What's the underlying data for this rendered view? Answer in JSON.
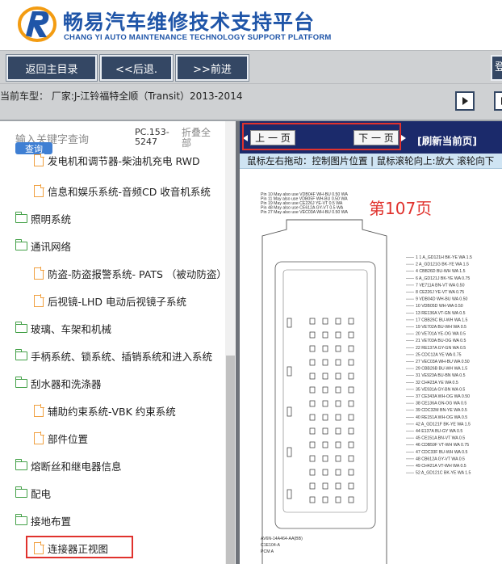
{
  "header": {
    "title": "畅易汽车维修技术支持平台",
    "subtitle": "CHANG YI AUTO MAINTENANCE TECHNOLOGY SUPPORT PLATFORM"
  },
  "toolbar": {
    "home_label": "返回主目录",
    "back_label": "<<后退.",
    "forward_label": ">>前进",
    "right_partial": "登"
  },
  "info": {
    "vehicle": "当前车型： 厂家:J-江铃福特全顺（Transit）2013-2014"
  },
  "search": {
    "placeholder": "输入关键字查询",
    "button": "查询",
    "pc_code": "PC.153-5247",
    "collapse": "折叠全部"
  },
  "tree": [
    {
      "label": "发电机和调节器-柴油机充电 RWD",
      "type": "page"
    },
    {
      "label": "信息和娱乐系统-音频CD 收音机系统",
      "type": "page"
    },
    {
      "label": "照明系统",
      "type": "folder"
    },
    {
      "label": "通讯网络",
      "type": "folder"
    },
    {
      "label": "防盗-防盗报警系统- PATS （被动防盗）",
      "type": "page"
    },
    {
      "label": "后视镜-LHD 电动后视镜子系统",
      "type": "page"
    },
    {
      "label": "玻璃、车架和机械",
      "type": "folder"
    },
    {
      "label": "手柄系统、锁系统、插销系统和进入系统",
      "type": "folder"
    },
    {
      "label": "刮水器和洗涤器",
      "type": "folder"
    },
    {
      "label": "辅助约束系统-VBK 约束系统",
      "type": "page"
    },
    {
      "label": "部件位置",
      "type": "page"
    },
    {
      "label": "熔断丝和继电器信息",
      "type": "folder"
    },
    {
      "label": "配电",
      "type": "folder"
    },
    {
      "label": "接地布置",
      "type": "folder"
    },
    {
      "label": "连接器正视图",
      "type": "page"
    }
  ],
  "viewer": {
    "prev": "上 一 页",
    "next": "下 一 页",
    "refresh": "[刷新当前页]",
    "hint": "鼠标左右拖动：控制图片位置 | 鼠标滚轮向上:放大   滚轮向下",
    "page": "第107页",
    "diagram_notes": [
      "Pin 10 May also use VDB04F WH-BU 0.50 WA",
      "Pin 11 May also use VDB05F WH-BU 0.50 WA",
      "Pin 19 May also use CE226J YE-VT 0.5 WA",
      "Pin 48 May also use CE612A GY-VT 0.5 WA",
      "Pin 27 May also use VEC03A WH-BU 0.50 WA"
    ],
    "diagram_footer": [
      "AV6N-14A464-AA(BB)",
      "C1E104-A",
      "PCM A"
    ],
    "pin_rows": [
      [
        "1",
        "",
        "",
        "1",
        "",
        "",
        "A_GD121H",
        "BK-YE",
        "WA 1.5"
      ],
      [
        "2",
        "A_GD121G",
        "BK-YE",
        "WA 1.5"
      ],
      [
        "4",
        "CBB26D",
        "BU-WH",
        "WA 1.5"
      ],
      [
        "6",
        "A_GD121J",
        "BK-YE",
        "WA 0.75"
      ],
      [
        "7",
        "VE711A",
        "BN-VT",
        "WA 0.50"
      ],
      [
        "8",
        "CE226J",
        "YE-VT",
        "WA 0.75"
      ],
      [
        "9",
        "VDB04D",
        "WH-BU",
        "WA 0.50"
      ],
      [
        "10",
        "VDB05D",
        "WH-WA",
        "0.50"
      ],
      [
        "13",
        "RE136A",
        "VT-GN",
        "WA 0.5"
      ],
      [
        "17",
        "CBB26C",
        "BU-WH",
        "WA 1.5"
      ],
      [
        "19",
        "VE702A",
        "BU-WH",
        "WA 0.5"
      ],
      [
        "20",
        "VE701A",
        "YE-OG",
        "WA 0.5"
      ],
      [
        "21",
        "VE703A",
        "BU-OG",
        "WA 0.5"
      ],
      [
        "22",
        "RE137A",
        "GY-GN",
        "WA 0.5"
      ],
      [
        "25",
        "CDC12A",
        "YE",
        "WA 0.75"
      ],
      [
        "27",
        "VEC03A",
        "WH-BU",
        "WA 0.50"
      ],
      [
        "29",
        "CBB26B",
        "BU-WH",
        "WA 1.5"
      ],
      [
        "31",
        "VE923A",
        "BU-BN",
        "WA 0.5"
      ],
      [
        "32",
        "CH423A",
        "YE",
        "WA 0.5"
      ],
      [
        "35",
        "VE931A",
        "GY-BN",
        "WA 0.5"
      ],
      [
        "37",
        "CE343A",
        "WH-OG",
        "WA 0.50"
      ],
      [
        "38",
        "CE136A",
        "GN-OG",
        "WA 0.5"
      ],
      [
        "39",
        "CDC32M",
        "BN-YE",
        "WA 0.5"
      ],
      [
        "40",
        "RE151A",
        "WH-OG",
        "WA 0.5"
      ],
      [
        "42",
        "A_GD121F",
        "BK-YE",
        "WA 1.5"
      ],
      [
        "44",
        "E137A",
        "BU-GY",
        "WA 0.5"
      ],
      [
        "45",
        "CE151A",
        "BN-VT",
        "WA 0.5"
      ],
      [
        "46",
        "CDB59F",
        "VT-WH",
        "WA 0.75"
      ],
      [
        "47",
        "CDC33F",
        "BU-WH",
        "WA 0.5"
      ],
      [
        "48",
        "CB612A",
        "GY-VT",
        "WA 0.5"
      ],
      [
        "49",
        "CH421A",
        "VT-WH",
        "WA 0.5"
      ],
      [
        "52",
        "A_GD121C",
        "BK-YE",
        "WA 1.5"
      ]
    ]
  },
  "colors": {
    "brand": "#1f55a8",
    "toolbar_button": "#344764",
    "viewer_nav": "#1b2a6b",
    "highlight": "#e0322d"
  }
}
